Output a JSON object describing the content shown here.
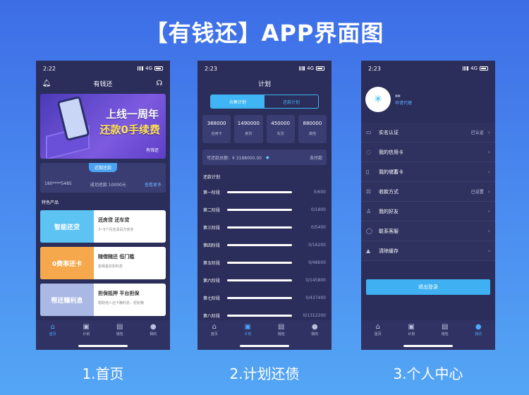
{
  "title": "【有钱还】APP界面图",
  "captions": [
    "1.首页",
    "2.计划还债",
    "3.个人中心"
  ],
  "screen1": {
    "time": "2:22",
    "network": "4G",
    "nav_title": "有钱还",
    "banner": {
      "line1": "上线一周年",
      "line2": "还款0手续费",
      "brand": "有钱还"
    },
    "recent": {
      "pill": "近期还款",
      "phone": "180****5485",
      "success": "成功还款 10000元",
      "more": "查看更多"
    },
    "section": "特色产品",
    "products": [
      {
        "tag": "智能还贷",
        "title": "还房贷 还车贷",
        "desc": "3~5个月还清百万债务",
        "color": "#5cc3f3"
      },
      {
        "tag": "0费率还卡",
        "title": "随借随还 低门槛",
        "desc": "担保金扣扣利息",
        "color": "#f5a94c"
      },
      {
        "tag": "帮还赚利息",
        "title": "担保抵押 平台担保",
        "desc": "帮助他人还卡赚利息，轻松赚",
        "color": "#a9b8e4"
      }
    ],
    "tabs": [
      {
        "label": "首页",
        "icon": "home-icon"
      },
      {
        "label": "计划",
        "icon": "plan-icon"
      },
      {
        "label": "钱包",
        "icon": "wallet-icon"
      },
      {
        "label": "我的",
        "icon": "user-icon"
      }
    ],
    "active_tab": 0
  },
  "screen2": {
    "time": "2:23",
    "network": "4G",
    "nav_title": "计划",
    "segments": [
      "众筹计划",
      "还款计划"
    ],
    "amounts": [
      {
        "value": "368000",
        "label": "信用卡"
      },
      {
        "value": "1490000",
        "label": "房贷"
      },
      {
        "value": "450000",
        "label": "车贷"
      },
      {
        "value": "880000",
        "label": "其他"
      }
    ],
    "pay": {
      "total": "可还款总额：¥ 3188000.00",
      "action": "去付款"
    },
    "plan_title": "还款计划",
    "stages": [
      {
        "name": "第一阶段",
        "value": "0/600"
      },
      {
        "name": "第二阶段",
        "value": "0/1800"
      },
      {
        "name": "第三阶段",
        "value": "0/5400"
      },
      {
        "name": "第四阶段",
        "value": "0/16200"
      },
      {
        "name": "第五阶段",
        "value": "0/48600"
      },
      {
        "name": "第六阶段",
        "value": "0/145800"
      },
      {
        "name": "第七阶段",
        "value": "0/437400"
      },
      {
        "name": "第八阶段",
        "value": "0/1312200"
      }
    ],
    "tabs": [
      {
        "label": "首页",
        "icon": "home-icon"
      },
      {
        "label": "计划",
        "icon": "plan-icon"
      },
      {
        "label": "钱包",
        "icon": "wallet-icon"
      },
      {
        "label": "我的",
        "icon": "user-icon"
      }
    ],
    "active_tab": 1
  },
  "screen3": {
    "time": "2:23",
    "network": "4G",
    "username": "■■",
    "agent": "申请代理",
    "menu": [
      {
        "label": "实名认证",
        "status": "已认证",
        "icon": "id-card-icon"
      },
      {
        "label": "我的信用卡",
        "status": "",
        "icon": "credit-card-icon"
      },
      {
        "label": "我的储蓄卡",
        "status": "",
        "icon": "debit-card-icon"
      },
      {
        "label": "收款方式",
        "status": "已设置",
        "icon": "scan-icon"
      },
      {
        "label": "我的好友",
        "status": "",
        "icon": "friend-icon"
      },
      {
        "label": "联系客服",
        "status": "",
        "icon": "chat-icon"
      },
      {
        "label": "清除缓存",
        "status": "",
        "icon": "clean-icon"
      }
    ],
    "logout": "退出登录",
    "tabs": [
      {
        "label": "首页",
        "icon": "home-icon"
      },
      {
        "label": "计划",
        "icon": "plan-icon"
      },
      {
        "label": "钱包",
        "icon": "wallet-icon"
      },
      {
        "label": "我的",
        "icon": "user-icon"
      }
    ],
    "active_tab": 3
  }
}
